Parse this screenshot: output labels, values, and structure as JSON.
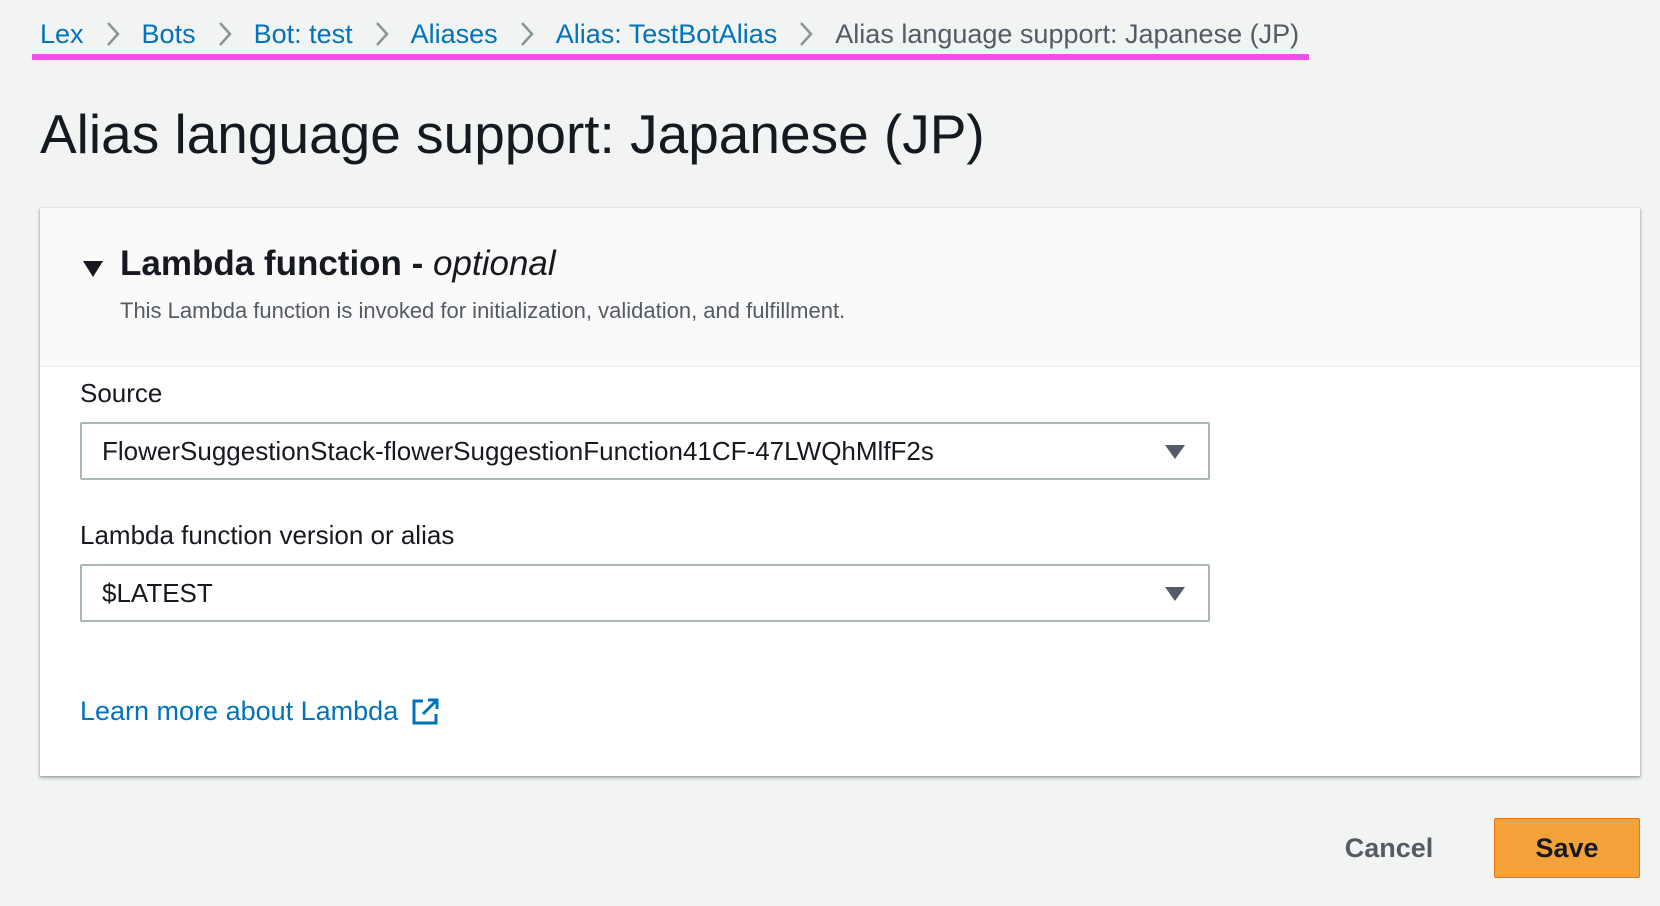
{
  "breadcrumb": {
    "items": [
      {
        "label": "Lex"
      },
      {
        "label": "Bots"
      },
      {
        "label": "Bot: test"
      },
      {
        "label": "Aliases"
      },
      {
        "label": "Alias: TestBotAlias"
      },
      {
        "label": "Alias language support: Japanese (JP)"
      }
    ]
  },
  "page": {
    "title": "Alias language support: Japanese (JP)"
  },
  "lambda_panel": {
    "title": "Lambda function -",
    "title_optional": "optional",
    "description": "This Lambda function is invoked for initialization, validation, and fulfillment.",
    "source_label": "Source",
    "source_value": "FlowerSuggestionStack-flowerSuggestionFunction41CF-47LWQhMlfF2s",
    "version_label": "Lambda function version or alias",
    "version_value": "$LATEST",
    "learn_more": "Learn more about Lambda"
  },
  "footer": {
    "cancel_label": "Cancel",
    "save_label": "Save"
  },
  "colors": {
    "link": "#0073bb",
    "highlight_underline": "#f050f0",
    "primary_button": "#f3a23a",
    "background": "#f2f3f3"
  },
  "icons": [
    "chevron-right-icon",
    "caret-down-icon",
    "external-link-icon"
  ]
}
